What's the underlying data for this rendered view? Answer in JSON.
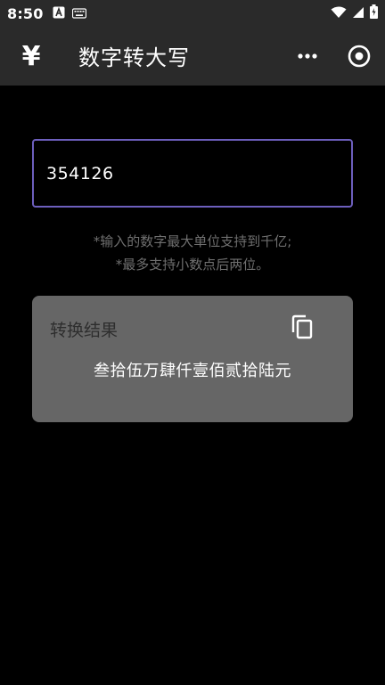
{
  "status_bar": {
    "time": "8:50"
  },
  "app_bar": {
    "icon_glyph": "¥",
    "title": "数字转大写"
  },
  "input": {
    "value": "354126",
    "placeholder": ""
  },
  "hints": {
    "line1": "*输入的数字最大单位支持到千亿;",
    "line2": "*最多支持小数点后两位。"
  },
  "result": {
    "label": "转换结果",
    "value": "叁拾伍万肆仟壹佰贰拾陆元"
  },
  "icons": {
    "app": "yen-icon",
    "more": "more-dots-icon",
    "target": "target-circle-icon",
    "copy": "copy-icon",
    "wifi": "wifi-icon",
    "signal": "signal-icon",
    "battery": "battery-icon",
    "notification": "notification-a-icon",
    "keyboard": "keyboard-icon"
  },
  "colors": {
    "background": "#000000",
    "app_bar": "#2a2a2a",
    "input_border": "#6d5fbd",
    "card": "#666666",
    "hint": "#6f6f6f"
  }
}
